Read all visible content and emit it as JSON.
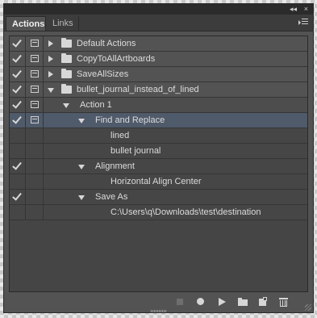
{
  "titlebar": {
    "collapse_glyph": "◂◂",
    "close_glyph": "×"
  },
  "tabs": [
    {
      "label": "Actions",
      "active": true
    },
    {
      "label": "Links",
      "active": false
    }
  ],
  "rows": [
    {
      "check": true,
      "dialog": true,
      "expanded": false,
      "kind": "set",
      "label": "Default Actions"
    },
    {
      "check": true,
      "dialog": true,
      "expanded": false,
      "kind": "set",
      "label": "CopyToAllArtboards"
    },
    {
      "check": true,
      "dialog": true,
      "expanded": false,
      "kind": "set",
      "label": "SaveAllSizes"
    },
    {
      "check": true,
      "dialog": true,
      "expanded": true,
      "kind": "set",
      "label": "bullet_journal_instead_of_lined"
    },
    {
      "check": true,
      "dialog": true,
      "expanded": true,
      "kind": "action",
      "label": "Action 1"
    },
    {
      "check": true,
      "dialog": true,
      "expanded": true,
      "kind": "step",
      "label": "Find and Replace",
      "selected": true
    },
    {
      "check": false,
      "dialog": false,
      "kind": "param",
      "label": "lined"
    },
    {
      "check": false,
      "dialog": false,
      "kind": "param",
      "label": "bullet journal"
    },
    {
      "check": true,
      "dialog": false,
      "expanded": true,
      "kind": "step",
      "label": "Alignment"
    },
    {
      "check": false,
      "dialog": false,
      "kind": "param",
      "label": "Horizontal Align Center"
    },
    {
      "check": true,
      "dialog": false,
      "expanded": true,
      "kind": "step",
      "label": "Save As"
    },
    {
      "check": false,
      "dialog": false,
      "kind": "param",
      "label": "C:\\Users\\q\\Downloads\\test\\destination"
    }
  ],
  "footer": {
    "buttons": [
      "stop-recording-icon",
      "record-icon",
      "play-icon",
      "new-set-folder-icon",
      "new-action-icon",
      "delete-trash-icon"
    ]
  },
  "colors": {
    "panel_bg": "#535353",
    "selected_row": "#4f5a6b",
    "text": "#dcdcdc"
  }
}
